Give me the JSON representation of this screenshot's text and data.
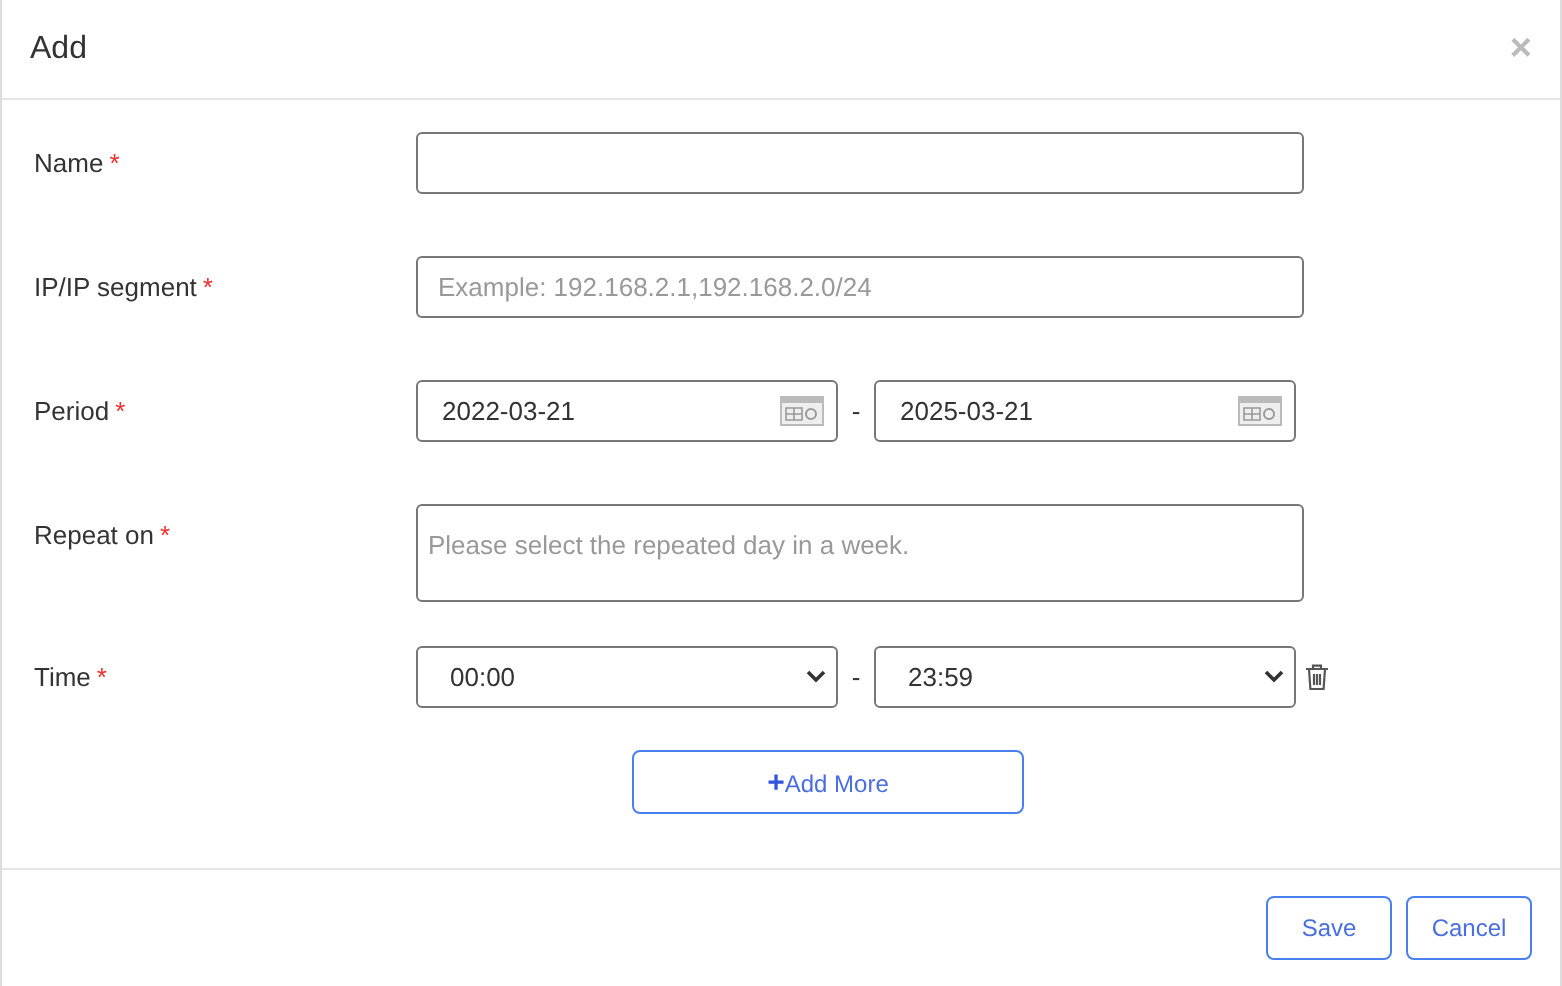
{
  "dialog": {
    "title": "Add",
    "close": "×"
  },
  "fields": [
    {
      "kind": "text",
      "label": "Name",
      "required_mark": "*"
    },
    {
      "kind": "text",
      "label": "IP/IP segment",
      "required_mark": "*",
      "placeholder": "Example: 192.168.2.1,192.168.2.0/24"
    },
    {
      "kind": "date_range",
      "label": "Period",
      "required_mark": "*",
      "from": "2022-03-21",
      "separator": "-",
      "to": "2025-03-21"
    },
    {
      "kind": "textarea",
      "label": "Repeat on",
      "required_mark": "*",
      "placeholder": "Please select the repeated day in a week."
    },
    {
      "kind": "time_range",
      "label": "Time",
      "required_mark": "*",
      "from": "00:00",
      "separator": "-",
      "to": "23:59"
    }
  ],
  "add_more": {
    "icon": "+",
    "label": "Add More"
  },
  "buttons": [
    "Save",
    "Cancel"
  ]
}
